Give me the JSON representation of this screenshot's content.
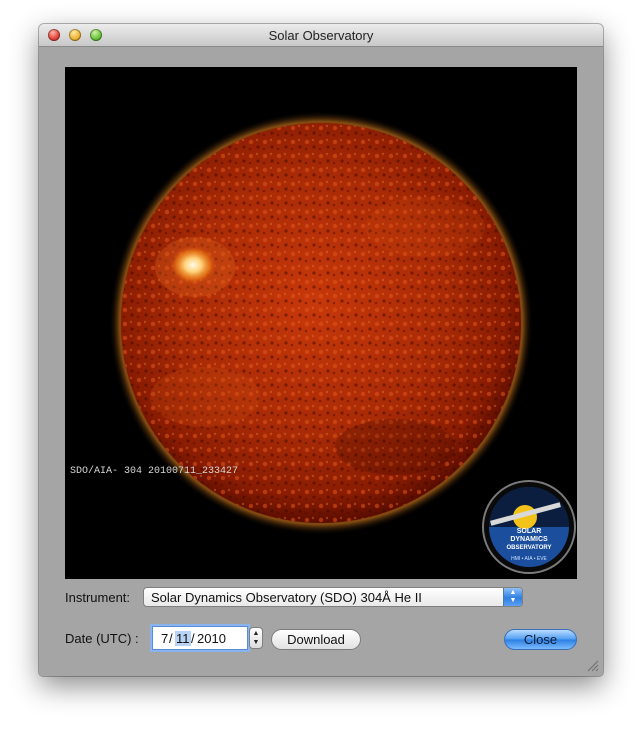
{
  "window": {
    "title": "Solar Observatory"
  },
  "image": {
    "overlay_caption": "SDO/AIA- 304 20100711_233427",
    "logo": {
      "line1": "SOLAR",
      "line2": "DYNAMICS",
      "line3": "OBSERVATORY",
      "footer": "HMI • AIA • EVE"
    }
  },
  "instrument": {
    "label": "Instrument:",
    "selected": "Solar Dynamics Observatory (SDO) 304Å He II"
  },
  "date": {
    "label": "Date (UTC) :",
    "month": "7",
    "day": "11",
    "year": "2010",
    "sep": "/"
  },
  "buttons": {
    "download": "Download",
    "close": "Close"
  },
  "icons": {
    "close": "close-window-icon",
    "minimize": "minimize-window-icon",
    "zoom": "zoom-window-icon",
    "popup_arrows": "chevron-updown-icon",
    "stepper": "stepper-updown-icon",
    "resize": "resize-grip-icon"
  },
  "colors": {
    "window_bg": "#a5a5a5",
    "accent": "#2b7ee3",
    "sun_core": "#b42a06",
    "sun_edge": "#5c0d00"
  }
}
